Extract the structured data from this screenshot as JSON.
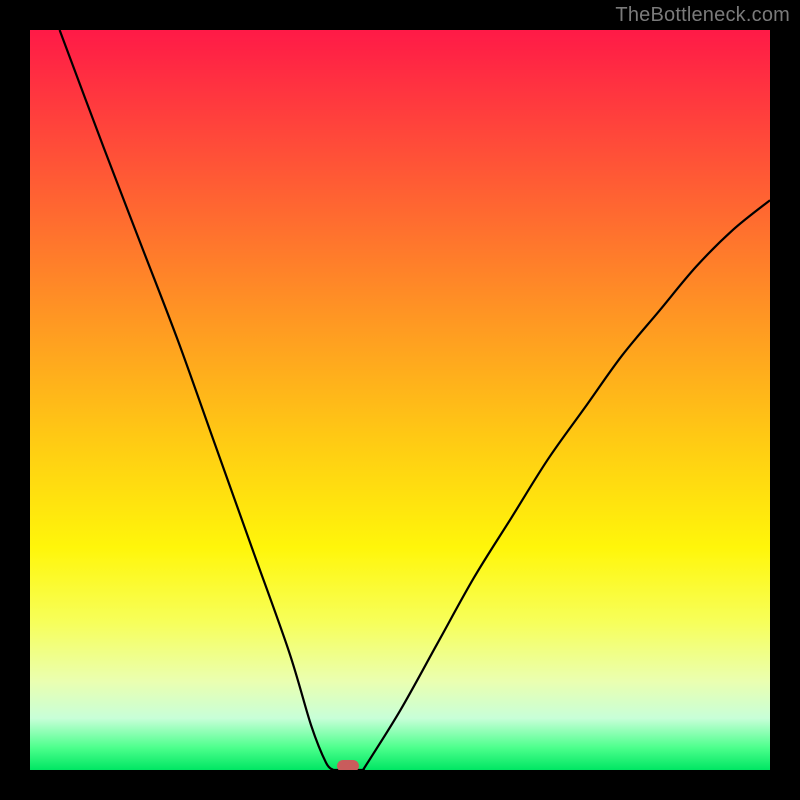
{
  "watermark": "TheBottleneck.com",
  "chart_data": {
    "type": "line",
    "title": "",
    "xlabel": "",
    "ylabel": "",
    "xlim": [
      0,
      100
    ],
    "ylim": [
      0,
      100
    ],
    "grid": false,
    "legend": false,
    "series": [
      {
        "name": "left-branch",
        "x": [
          4,
          10,
          15,
          20,
          25,
          30,
          35,
          38,
          40,
          41
        ],
        "y": [
          100,
          84,
          71,
          58,
          44,
          30,
          16,
          6,
          1,
          0
        ]
      },
      {
        "name": "flat",
        "x": [
          41,
          45
        ],
        "y": [
          0,
          0
        ]
      },
      {
        "name": "right-branch",
        "x": [
          45,
          50,
          55,
          60,
          65,
          70,
          75,
          80,
          85,
          90,
          95,
          100
        ],
        "y": [
          0,
          8,
          17,
          26,
          34,
          42,
          49,
          56,
          62,
          68,
          73,
          77
        ]
      }
    ],
    "marker": {
      "x": 43,
      "y": 0,
      "color": "#c95c5c"
    },
    "background_gradient": {
      "stops": [
        {
          "pos": 0,
          "color": "#ff1a47"
        },
        {
          "pos": 25,
          "color": "#ff6a30"
        },
        {
          "pos": 55,
          "color": "#ffc914"
        },
        {
          "pos": 80,
          "color": "#f7ff5a"
        },
        {
          "pos": 100,
          "color": "#00e663"
        }
      ]
    }
  }
}
